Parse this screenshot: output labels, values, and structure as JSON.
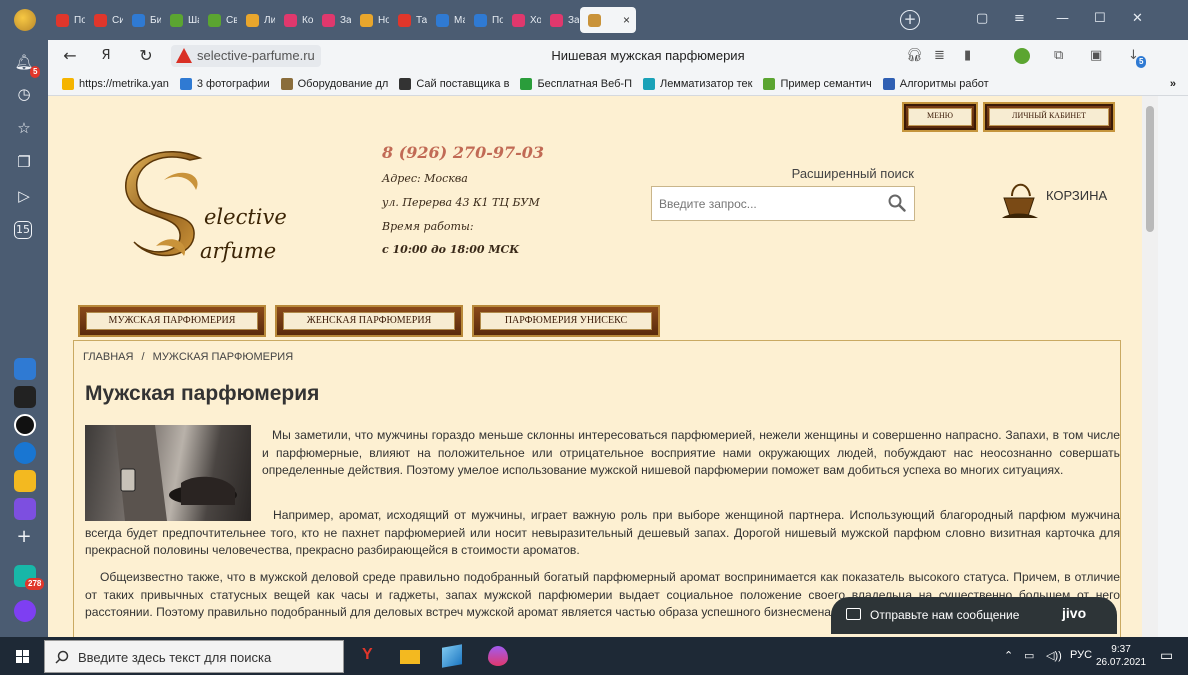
{
  "browser": {
    "tabs": [
      {
        "label": "По",
        "color": "#e0362b"
      },
      {
        "label": "Си",
        "color": "#e0362b"
      },
      {
        "label": "Би",
        "color": "#2f7ad3"
      },
      {
        "label": "Ша",
        "color": "#5ba531"
      },
      {
        "label": "Св",
        "color": "#5ba531"
      },
      {
        "label": "Ли",
        "color": "#e9a62c"
      },
      {
        "label": "Ко",
        "color": "#e0386d"
      },
      {
        "label": "Зап",
        "color": "#e0386d"
      },
      {
        "label": "Но",
        "color": "#e9a62c"
      },
      {
        "label": "Тат",
        "color": "#e0362b"
      },
      {
        "label": "Ма",
        "color": "#2f7ad3"
      },
      {
        "label": "По",
        "color": "#2f7ad3"
      },
      {
        "label": "Хо",
        "color": "#e0386d"
      },
      {
        "label": "Зап",
        "color": "#e0386d"
      }
    ],
    "active_tab_close": "×",
    "new_tab": "+",
    "url": "selective-parfume.ru",
    "page_title": "Нишевая мужская парфюмерия",
    "sidebar_badges": {
      "notifications": "5",
      "apps": "278"
    },
    "extension_badge": "5"
  },
  "bookmarks": [
    {
      "label": "https://metrika.yan",
      "color": "#f5b400"
    },
    {
      "label": "3 фотографии",
      "color": "#2f7ad3"
    },
    {
      "label": "Оборудование дл",
      "color": "#8a6d3b"
    },
    {
      "label": "Сай поставщика в",
      "color": "#333333"
    },
    {
      "label": "Бесплатная Веб-П",
      "color": "#2a9d3b"
    },
    {
      "label": "Лемматизатор тек",
      "color": "#1aa2b8"
    },
    {
      "label": "Пример семантич",
      "color": "#5ba531"
    },
    {
      "label": "Алгоритмы работ",
      "color": "#2f5fb3"
    }
  ],
  "bookmarks_more": "»",
  "site": {
    "top_buttons": {
      "menu": "МЕНЮ",
      "cabinet": "ЛИЧНЫЙ КАБИНЕТ"
    },
    "logo_text": [
      "elective",
      "arfume"
    ],
    "phone": "8 (926) 270-97-03",
    "address_label": "Адрес: Москва",
    "address_line": "ул. Перерва 43 К1 ТЦ БУМ",
    "hours_label": "Время работы:",
    "hours": "с 10:00 до 18:00 МСК",
    "advanced_search": "Расширенный поиск",
    "search_placeholder": "Введите запрос...",
    "cart_label": "КОРЗИНА",
    "categories": [
      "МУЖСКАЯ ПАРФЮМЕРИЯ",
      "ЖЕНСКАЯ ПАРФЮМЕРИЯ",
      "ПАРФЮМЕРИЯ УНИСЕКС"
    ],
    "breadcrumb": {
      "home": "ГЛАВНАЯ",
      "sep": "/",
      "current": "МУЖСКАЯ ПАРФЮМЕРИЯ"
    },
    "heading": "Мужская парфюмерия",
    "paragraphs": [
      "Мы заметили, что мужчины гораздо меньше склонны интересоваться парфюмерией, нежели женщины и совершенно напрасно. Запахи, в том числе и парфюмерные, влияют на положительное или отрицательное восприятие нами окружающих людей, побуждают нас неосознанно совершать определенные действия. Поэтому умелое использование мужской нишевой парфюмерии поможет вам добиться успеха во многих ситуациях.",
      "Например, аромат, исходящий от мужчины, играет важную роль при выборе женщиной партнера. Использующий благородный парфюм мужчина всегда будет предпочтительнее того, кто не пахнет парфюмерией или носит невыразительный дешевый запах. Дорогой нишевый мужской парфюм словно визитная карточка для прекрасной половины человечества, прекрасно разбирающейся в стоимости ароматов.",
      "Общеизвестно также, что в мужской деловой среде правильно подобранный богатый парфюмерный аромат воспринимается как показатель высокого статуса. Причем, в отличие от таких привычных статусных вещей как часы и гаджеты, запах мужской парфюмерии выдает социальное положение своего владельца на существенно большем от него расстоянии. Поэтому правильно подобранный для деловых встреч мужской аромат является частью образа успешного бизнесмена, сделка с которым сулит выгоду."
    ],
    "chat_label": "Отправьте нам сообщение",
    "chat_brand": "jivo"
  },
  "taskbar": {
    "search_placeholder": "Введите здесь текст для поиска",
    "language": "РУС",
    "time": "9:37",
    "date": "26.07.2021"
  }
}
